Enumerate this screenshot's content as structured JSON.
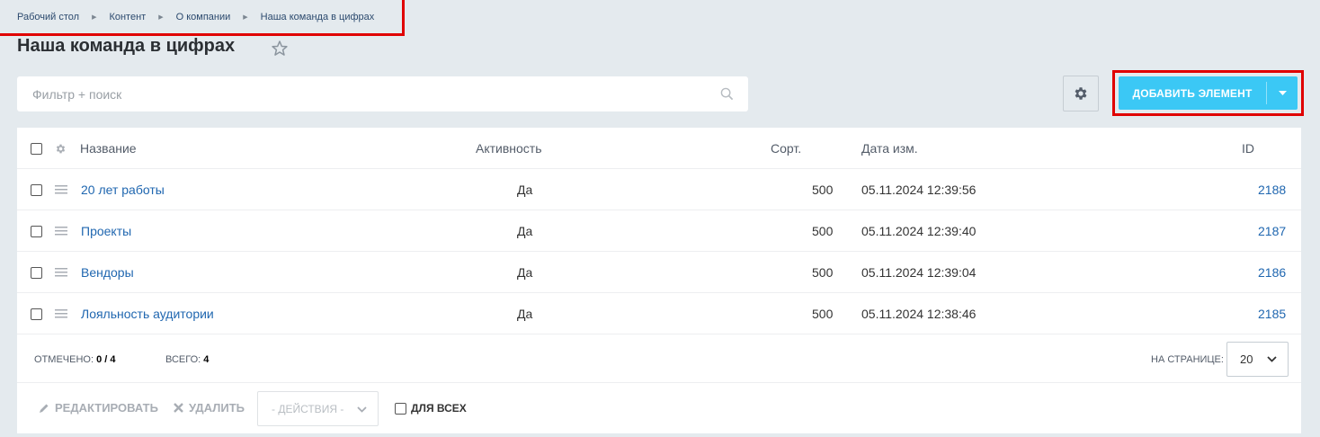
{
  "breadcrumb": [
    "Рабочий стол",
    "Контент",
    "О компании",
    "Наша команда в цифрах"
  ],
  "title": "Наша команда в цифрах",
  "search": {
    "placeholder": "Фильтр + поиск"
  },
  "add_button": {
    "label": "ДОБАВИТЬ ЭЛЕМЕНТ",
    "color": "#3bc8f5"
  },
  "highlight_color": "#e00000",
  "columns": {
    "name": "Название",
    "active": "Активность",
    "sort": "Сорт.",
    "date": "Дата изм.",
    "id": "ID"
  },
  "rows": [
    {
      "name": "20 лет работы",
      "active": "Да",
      "sort": "500",
      "date": "05.11.2024 12:39:56",
      "id": "2188"
    },
    {
      "name": "Проекты",
      "active": "Да",
      "sort": "500",
      "date": "05.11.2024 12:39:40",
      "id": "2187"
    },
    {
      "name": "Вендоры",
      "active": "Да",
      "sort": "500",
      "date": "05.11.2024 12:39:04",
      "id": "2186"
    },
    {
      "name": "Лояльность аудитории",
      "active": "Да",
      "sort": "500",
      "date": "05.11.2024 12:38:46",
      "id": "2185"
    }
  ],
  "footer": {
    "selected_label": "ОТМЕЧЕНО:",
    "selected_value": "0 / 4",
    "total_label": "ВСЕГО:",
    "total_value": "4",
    "per_page_label": "НА СТРАНИЦЕ:",
    "per_page_value": "20"
  },
  "actions": {
    "edit": "РЕДАКТИРОВАТЬ",
    "delete": "УДАЛИТЬ",
    "actions_select": "- ДЕЙСТВИЯ -",
    "for_all": "ДЛЯ ВСЕХ"
  },
  "icons": [
    "chevron-right-icon",
    "star-icon",
    "search-icon",
    "gear-icon",
    "caret-down-icon",
    "drag-handle-icon",
    "pencil-icon",
    "cross-icon",
    "chevron-down-icon"
  ]
}
